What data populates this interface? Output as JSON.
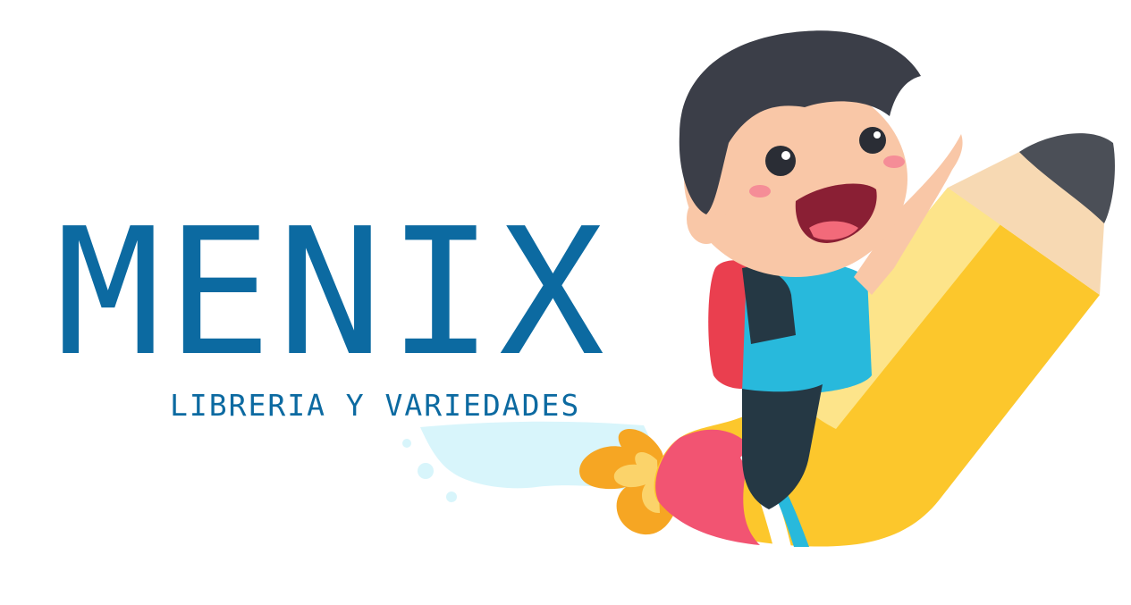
{
  "logo": {
    "name": "MENIX",
    "tagline": "LIBRERIA Y VARIEDADES"
  },
  "colors": {
    "brand_blue": "#0c6aa1",
    "pencil_yellow": "#fcc72c",
    "pencil_tip": "#f7d9b3",
    "pencil_lead": "#4b4f57",
    "rocket_pink": "#f25472",
    "flame_orange": "#f6a623",
    "hair": "#3b3e48",
    "shirt": "#28b9dc",
    "backpack": "#ea3f4f",
    "trail": "#d8f5fb"
  },
  "illustration": {
    "subject": "boy-riding-pencil-rocket"
  }
}
